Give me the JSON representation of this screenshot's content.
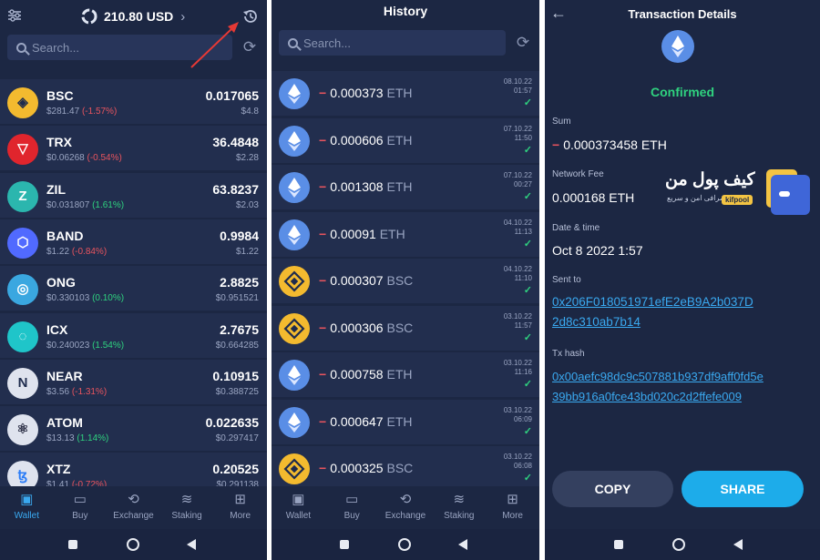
{
  "wallet": {
    "balance": "210.80 USD",
    "search_placeholder": "Search...",
    "coins": [
      {
        "symbol": "BSC",
        "price": "$281.47",
        "change": "(-1.57%)",
        "trend": "neg",
        "amount": "0.017065",
        "value": "$4.8",
        "color": "#f3ba2f",
        "icon": "bnb-icon",
        "glyph": "◈",
        "glyph_color": "#1e2b4d"
      },
      {
        "symbol": "TRX",
        "price": "$0.06268",
        "change": "(-0.54%)",
        "trend": "neg",
        "amount": "36.4848",
        "value": "$2.28",
        "color": "#e0252d",
        "icon": "tron-icon",
        "glyph": "▽",
        "glyph_color": "#ffffff"
      },
      {
        "symbol": "ZIL",
        "price": "$0.031807",
        "change": "(1.61%)",
        "trend": "pos",
        "amount": "63.8237",
        "value": "$2.03",
        "color": "#2bb6ae",
        "icon": "zilliqa-icon",
        "glyph": "Z",
        "glyph_color": "#ffffff"
      },
      {
        "symbol": "BAND",
        "price": "$1.22",
        "change": "(-0.84%)",
        "trend": "neg",
        "amount": "0.9984",
        "value": "$1.22",
        "color": "#516aff",
        "icon": "band-icon",
        "glyph": "⬡",
        "glyph_color": "#ffffff"
      },
      {
        "symbol": "ONG",
        "price": "$0.330103",
        "change": "(0.10%)",
        "trend": "pos",
        "amount": "2.8825",
        "value": "$0.951521",
        "color": "#3aa7e0",
        "icon": "ontology-gas-icon",
        "glyph": "◎",
        "glyph_color": "#ffffff"
      },
      {
        "symbol": "ICX",
        "price": "$0.240023",
        "change": "(1.54%)",
        "trend": "pos",
        "amount": "2.7675",
        "value": "$0.664285",
        "color": "#1fc5c9",
        "icon": "icon-coin-icon",
        "glyph": "◌",
        "glyph_color": "#ffffff"
      },
      {
        "symbol": "NEAR",
        "price": "$3.56",
        "change": "(-1.31%)",
        "trend": "neg",
        "amount": "0.10915",
        "value": "$0.388725",
        "color": "#dfe3ee",
        "icon": "near-icon",
        "glyph": "N",
        "glyph_color": "#1e2b4d"
      },
      {
        "symbol": "ATOM",
        "price": "$13.13",
        "change": "(1.14%)",
        "trend": "pos",
        "amount": "0.022635",
        "value": "$0.297417",
        "color": "#dfe3ee",
        "icon": "cosmos-icon",
        "glyph": "⚛",
        "glyph_color": "#2e3148"
      },
      {
        "symbol": "XTZ",
        "price": "$1.41",
        "change": "(-0.72%)",
        "trend": "neg",
        "amount": "0.20525",
        "value": "$0.291138",
        "color": "#dfe3ee",
        "icon": "tezos-icon",
        "glyph": "ꜩ",
        "glyph_color": "#2c7df7"
      }
    ]
  },
  "history": {
    "title": "History",
    "search_placeholder": "Search...",
    "items": [
      {
        "amount": "0.000373",
        "unit": "ETH",
        "date": "08.10.22",
        "time": "01:57",
        "icon": "ethereum-icon"
      },
      {
        "amount": "0.000606",
        "unit": "ETH",
        "date": "07.10.22",
        "time": "11:50",
        "icon": "ethereum-icon"
      },
      {
        "amount": "0.001308",
        "unit": "ETH",
        "date": "07.10.22",
        "time": "00:27",
        "icon": "ethereum-icon"
      },
      {
        "amount": "0.00091",
        "unit": "ETH",
        "date": "04.10.22",
        "time": "11:13",
        "icon": "ethereum-icon"
      },
      {
        "amount": "0.000307",
        "unit": "BSC",
        "date": "04.10.22",
        "time": "11:10",
        "icon": "bnb-icon"
      },
      {
        "amount": "0.000306",
        "unit": "BSC",
        "date": "03.10.22",
        "time": "11:57",
        "icon": "bnb-icon"
      },
      {
        "amount": "0.000758",
        "unit": "ETH",
        "date": "03.10.22",
        "time": "11:16",
        "icon": "ethereum-icon"
      },
      {
        "amount": "0.000647",
        "unit": "ETH",
        "date": "03.10.22",
        "time": "06:09",
        "icon": "ethereum-icon"
      },
      {
        "amount": "0.000325",
        "unit": "BSC",
        "date": "03.10.22",
        "time": "06:08",
        "icon": "bnb-icon"
      }
    ]
  },
  "details": {
    "title": "Transaction Details",
    "status": "Confirmed",
    "sum_label": "Sum",
    "sum_value": "0.000373458 ETH",
    "fee_label": "Network Fee",
    "fee_value": "0.000168 ETH",
    "date_label": "Date & time",
    "date_value": "Oct 8 2022 1:57",
    "sent_label": "Sent to",
    "sent_line1": "0x206F018051971efE2eB9A2b037D",
    "sent_line2": "2d8c310ab7b14",
    "hash_label": "Tx hash",
    "hash_line1": "0x00aefc98dc9c507881b937df9aff0fd5e",
    "hash_line2": "39bb916a0fce43bd020c2d2ffefe009",
    "copy_label": "COPY",
    "share_label": "SHARE",
    "watermark_text": "کیف پول من",
    "watermark_sub": "صرافی امن و سریع",
    "watermark_badge": "kifpool"
  },
  "nav": [
    "Wallet",
    "Buy",
    "Exchange",
    "Staking",
    "More"
  ],
  "colors": {
    "bg": "#1c2743",
    "row": "#222e4e",
    "accent": "#3aa9f0",
    "positive": "#2fd27f",
    "negative": "#e8545e",
    "arrow": "#e53935"
  }
}
